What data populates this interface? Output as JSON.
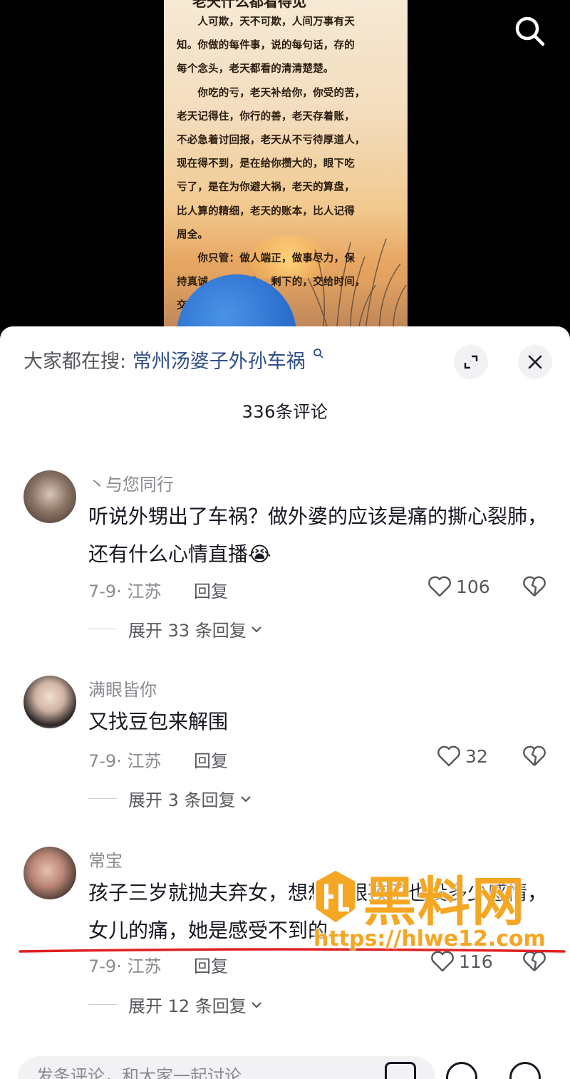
{
  "video": {
    "poster_title": "老天什么都看得见",
    "poster_text": "　　人可欺，天不可欺，人间万事有天\n知。你做的每件事，说的每句话，存的\n每个念头，老天都看的清清楚楚。\n　　你吃的亏，老天补给你，你受的苦，\n老天记得住，你行的善，老天存着账，\n不必急着讨回报，老天从不亏待厚道人，\n现在得不到，是在给你攒大的，眼下吃\n亏了，是在为你避大祸，老天的算盘，\n比人算的精细，老天的账本，比人记得\n周全。\n　　你只管：做人端正，做事尽力，保\n持真诚，守住良心，剩下的，交给时间，\n交给老天。"
  },
  "sheet": {
    "hot_search_prefix": "大家都在搜:",
    "hot_search_term": "常州汤婆子外孙车祸",
    "comment_count": "336条评论"
  },
  "comments": [
    {
      "username": "丶与您同行",
      "text": "听说外甥出了车祸？做外婆的应该是痛的撕心裂肺，还有什么心情直播😭",
      "meta": "7-9· 江苏",
      "reply": "回复",
      "likes": "106",
      "expand": "展开 33 条回复"
    },
    {
      "username": "满眼皆你",
      "text": "又找豆包来解围",
      "meta": "7-9· 江苏",
      "reply": "回复",
      "likes": "32",
      "expand": "展开 3 条回复"
    },
    {
      "username": "常宝",
      "text": "孩子三岁就抛夫弃女，想想么跟孩子也没多少感情，女儿的痛，她是感受不到的",
      "meta": "7-9· 江苏",
      "reply": "回复",
      "likes": "116",
      "expand": "展开 12 条回复"
    }
  ],
  "watermark": {
    "brand": "黑料网",
    "url": "https://hlwe12.com"
  },
  "input": {
    "placeholder": "发条评论，和大家一起讨论"
  },
  "colors": {
    "hot_term": "#2f4d87",
    "watermark": "#f5a623",
    "red_line": "#e02020"
  }
}
